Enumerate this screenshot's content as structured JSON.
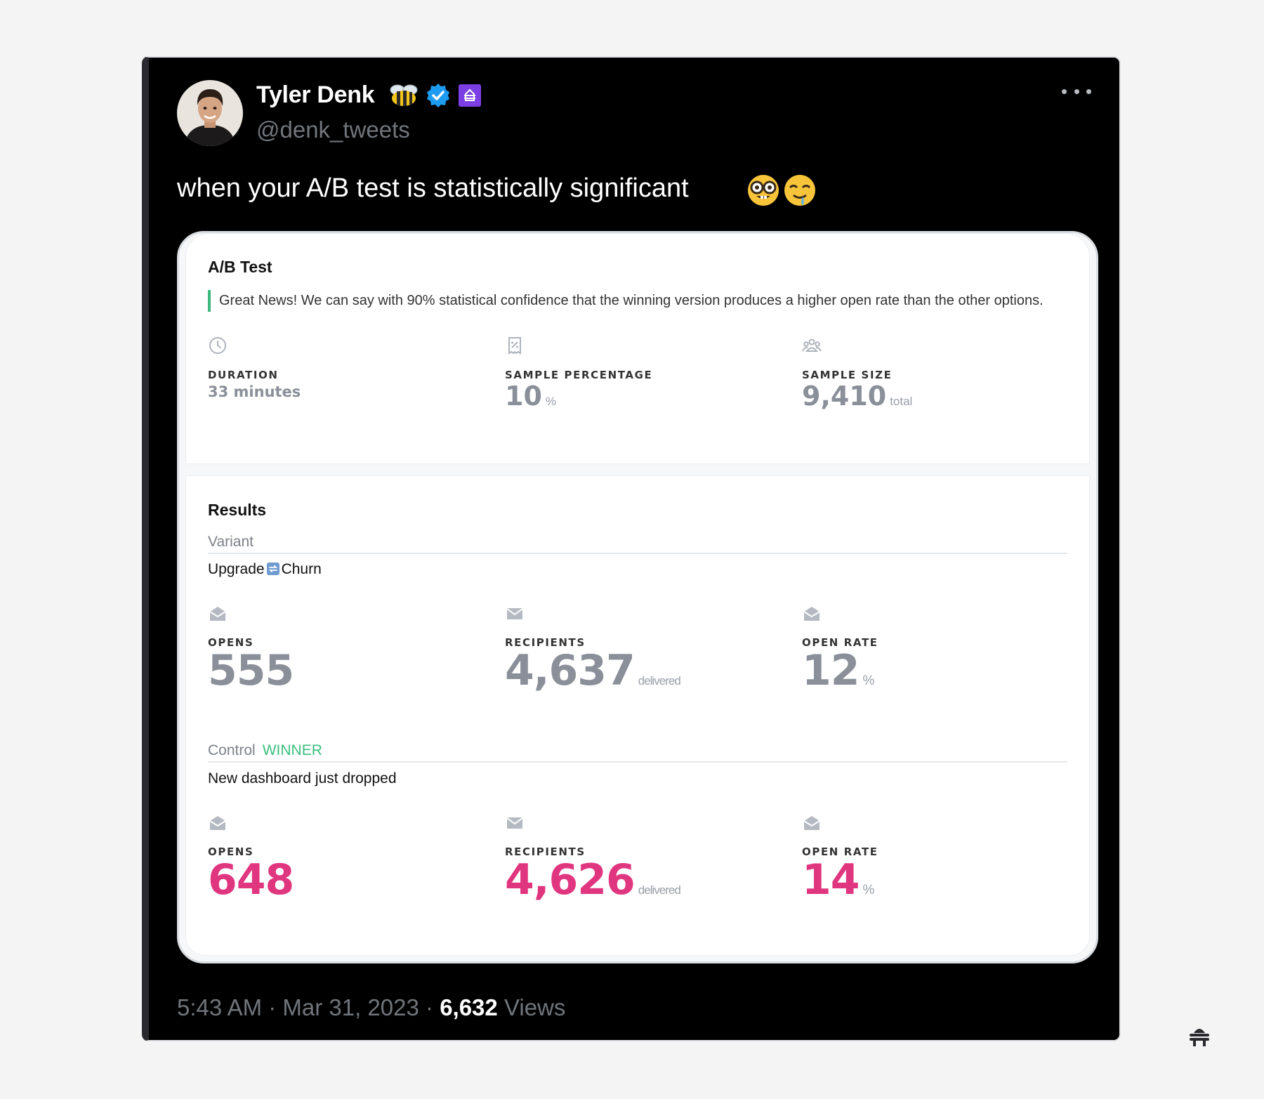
{
  "tweet": {
    "author_name": "Tyler Denk",
    "handle": "@denk_tweets",
    "text": "when your A/B test is statistically significant",
    "timestamp": "5:43 AM · Mar 31, 2023 · ",
    "views_count": "6,632",
    "views_label": "Views",
    "emojis": [
      "nerd-face-emoji",
      "drooling-face-emoji"
    ],
    "badges": [
      "bee-emoji",
      "verified-badge-icon",
      "affiliate-badge-icon"
    ]
  },
  "ab_test": {
    "title": "A/B Test",
    "message": "Great News! We can say with 90% statistical confidence that the winning version produces a higher open rate than the other options.",
    "duration_label": "DURATION",
    "duration_value": "33 minutes",
    "sample_pct_label": "SAMPLE PERCENTAGE",
    "sample_pct_value": "10",
    "sample_pct_unit": "%",
    "sample_size_label": "SAMPLE SIZE",
    "sample_size_value": "9,410",
    "sample_size_unit": "total"
  },
  "results": {
    "title": "Results",
    "variant": {
      "header": "Variant",
      "subject_part1": "Upgrade",
      "subject_part2": "Churn",
      "opens_label": "OPENS",
      "opens": "555",
      "recipients_label": "RECIPIENTS",
      "recipients": "4,637",
      "recipients_unit": "delivered",
      "open_rate_label": "OPEN RATE",
      "open_rate": "12",
      "open_rate_unit": "%"
    },
    "control": {
      "header": "Control",
      "winner": "WINNER",
      "subject": "New dashboard just dropped",
      "opens_label": "OPENS",
      "opens": "648",
      "recipients_label": "RECIPIENTS",
      "recipients": "4,626",
      "recipients_unit": "delivered",
      "open_rate_label": "OPEN RATE",
      "open_rate": "14",
      "open_rate_unit": "%"
    }
  },
  "colors": {
    "winner_green": "#3bbf7f",
    "highlight_pink": "#e0357f",
    "muted_gray": "#8a8f99",
    "verified_blue": "#1d9bf0"
  }
}
